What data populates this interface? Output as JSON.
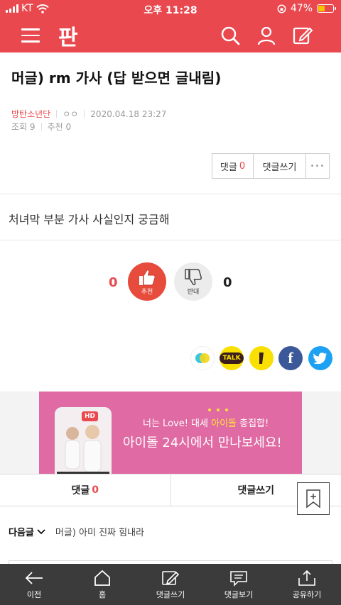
{
  "status_bar": {
    "carrier": "KT",
    "time": "오후 11:28",
    "battery": "47%",
    "battery_level": 0.47
  },
  "header": {
    "logo": "판"
  },
  "post": {
    "title": "머글) rm 가사 (답 받으면 글내림)",
    "category": "방탄소년단",
    "author": "ㅇㅇ",
    "date": "2020.04.18 23:27",
    "views_label": "조회",
    "views": "9",
    "likes_label": "추천",
    "likes": "0",
    "body": "처녀막 부분 가사 사실인지 궁금해"
  },
  "actions": {
    "comment_label": "댓글",
    "comment_count": "0",
    "write_label": "댓글쓰기",
    "more": "•••"
  },
  "votes": {
    "up_count": "0",
    "up_label": "추천",
    "down_count": "0",
    "down_label": "반대"
  },
  "share": {
    "kakaotalk_label": "TALK",
    "facebook_label": "f"
  },
  "banner": {
    "line1_a": "너는 Love! 대세 ",
    "line1_b": "아이돌",
    "line1_c": " 총집합!",
    "line2": "아이돌 24시에서 만나보세요!",
    "badge": "HD"
  },
  "comment_bar": {
    "comment_label": "댓글",
    "comment_count": "0",
    "write_label": "댓글쓰기"
  },
  "next": {
    "label": "다음글",
    "post_title": "머글) 아미 진짜 힘내라"
  },
  "tabbar": [
    {
      "label": "이전"
    },
    {
      "label": "홈"
    },
    {
      "label": "댓글쓰기"
    },
    {
      "label": "댓글보기"
    },
    {
      "label": "공유하기"
    }
  ],
  "colors": {
    "brand": "#e8484e",
    "tabbar": "#3b3b3b"
  }
}
